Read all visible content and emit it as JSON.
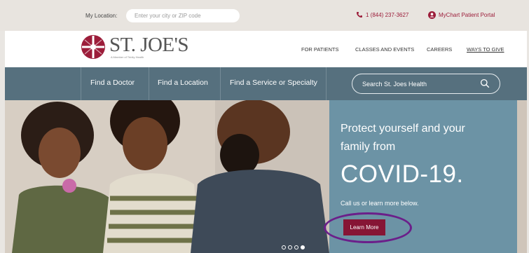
{
  "topbar": {
    "location_label": "My Location:",
    "location_placeholder": "Enter your city or ZIP code",
    "phone": "1 (844) 237-3627",
    "portal": "MyChart Patient Portal"
  },
  "header": {
    "logo_name": "ST. JOE'S",
    "logo_subtitle": "A Member of Trinity Health",
    "nav": [
      "FOR PATIENTS",
      "CLASSES AND EVENTS",
      "CAREERS",
      "WAYS TO GIVE"
    ]
  },
  "navbar": {
    "links": [
      "Find a Doctor",
      "Find a Location",
      "Find a Service or Specialty"
    ],
    "search_placeholder": "Search St. Joes Health"
  },
  "hero": {
    "line1": "Protect yourself and your",
    "line2": "family from",
    "big": "COVID-19.",
    "small": "Call us or learn more below.",
    "button": "Learn More",
    "slide_count": 4,
    "active_slide": 4
  },
  "colors": {
    "brand": "#9c1d3a",
    "nav_bar": "#56707e",
    "hero_panel": "#6c93a5",
    "button": "#861535",
    "annotation_ring": "#6b1f8a"
  },
  "icons": [
    "phone-icon",
    "user-icon",
    "logo-cross-icon",
    "search-icon"
  ]
}
